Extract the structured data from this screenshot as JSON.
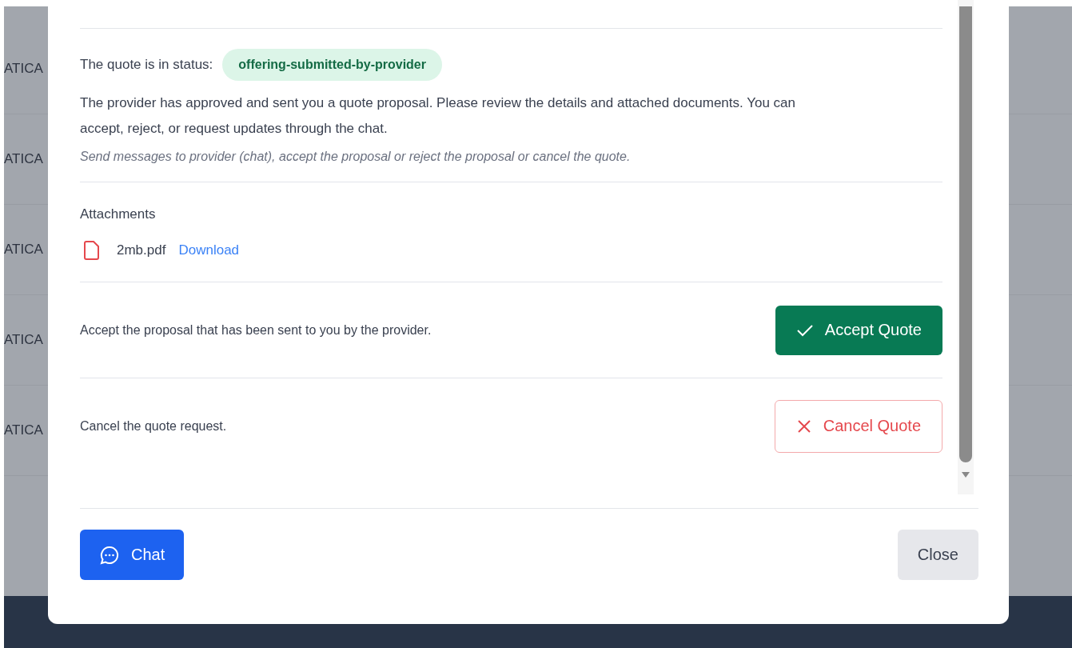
{
  "background_rows": [
    {
      "column_1": "ATICA"
    },
    {
      "column_1": "ATICA"
    },
    {
      "column_1": "ATICA"
    },
    {
      "column_1": "ATICA"
    },
    {
      "column_1": "ATICA"
    }
  ],
  "modal": {
    "status_label": "The quote is in status:",
    "status": "offering-submitted-by-provider",
    "description": "The provider has approved and sent you a quote proposal. Please review the details and attached documents. You can accept, reject, or request updates through the chat.",
    "hint": "Send messages to provider (chat), accept the proposal or reject the proposal or cancel the quote.",
    "attachments_title": "Attachments",
    "attachments": [
      {
        "name": "2mb.pdf",
        "link": "Download"
      }
    ],
    "actions": [
      {
        "kind": "accept",
        "text": "Accept the proposal that has been sent to you by the provider.",
        "button": "Accept Quote"
      },
      {
        "kind": "cancel",
        "text": "Cancel the quote request.",
        "button": "Cancel Quote"
      }
    ],
    "footer": {
      "chat_button": "Chat",
      "close_button": "Close"
    }
  }
}
